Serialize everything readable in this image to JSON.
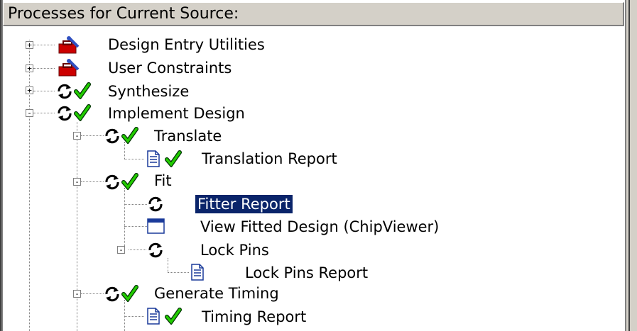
{
  "header": {
    "title": "Processes for Current Source:"
  },
  "items": [
    {
      "label": "Design Entry Utilities",
      "icon": "toolbox-icon",
      "expander": "+"
    },
    {
      "label": "User Constraints",
      "icon": "toolbox-icon",
      "expander": "+"
    },
    {
      "label": "Synthesize",
      "icon": "process-run-icon",
      "status": "check-icon",
      "expander": "+"
    },
    {
      "label": "Implement Design",
      "icon": "process-run-icon",
      "status": "check-icon",
      "expander": "-"
    },
    {
      "label": "Translate",
      "icon": "process-run-icon",
      "status": "check-icon",
      "expander": "-"
    },
    {
      "label": "Translation Report",
      "icon": "report-icon",
      "status": "check-icon"
    },
    {
      "label": "Fit",
      "icon": "process-run-icon",
      "status": "check-icon",
      "expander": "-"
    },
    {
      "label": "Fitter Report",
      "icon": "process-run-icon",
      "selected": true
    },
    {
      "label": "View Fitted Design (ChipViewer)",
      "icon": "window-icon"
    },
    {
      "label": "Lock Pins",
      "icon": "process-run-icon",
      "expander": "-"
    },
    {
      "label": "Lock Pins Report",
      "icon": "report-icon"
    },
    {
      "label": "Generate Timing",
      "icon": "process-run-icon",
      "status": "check-icon",
      "expander": "-"
    },
    {
      "label": "Timing Report",
      "icon": "report-icon",
      "status": "check-icon"
    }
  ],
  "colors": {
    "selection": "#0a246a",
    "check": "#22aa00",
    "toolbox": "#cc0000",
    "report": "#1a3a9a"
  }
}
